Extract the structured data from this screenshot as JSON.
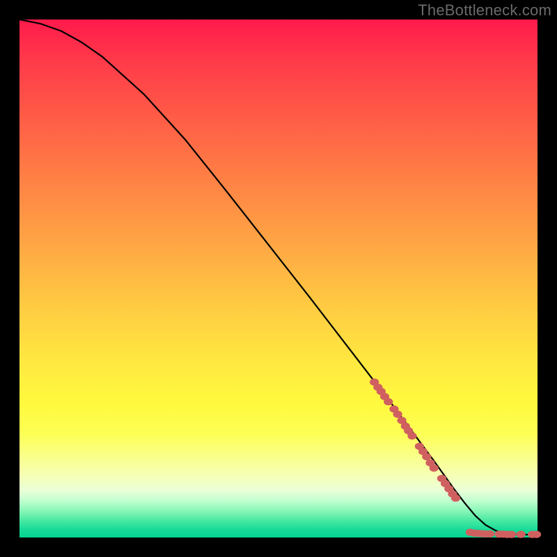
{
  "watermark": "TheBottleneck.com",
  "colors": {
    "marker": "#d06060",
    "line": "#000000",
    "frame": "#000000"
  },
  "chart_data": {
    "type": "line",
    "title": "",
    "xlabel": "",
    "ylabel": "",
    "xlim": [
      0,
      100
    ],
    "ylim": [
      0,
      100
    ],
    "series": [
      {
        "name": "curve",
        "x": [
          0,
          4,
          8,
          12,
          16,
          24,
          32,
          40,
          48,
          56,
          64,
          72,
          76,
          80,
          82,
          84,
          86,
          88,
          90,
          92,
          94,
          96,
          98,
          100
        ],
        "y": [
          100,
          99.2,
          97.8,
          95.6,
          92.8,
          85.6,
          76.8,
          66.8,
          56.6,
          46.4,
          36.0,
          25.6,
          20.2,
          14.8,
          12.0,
          9.2,
          6.6,
          4.2,
          2.4,
          1.3,
          0.8,
          0.6,
          0.55,
          0.55
        ]
      }
    ],
    "markers": [
      {
        "x": 68.5,
        "y": 30.0
      },
      {
        "x": 69.2,
        "y": 29.0
      },
      {
        "x": 69.8,
        "y": 28.2
      },
      {
        "x": 70.5,
        "y": 27.2
      },
      {
        "x": 71.2,
        "y": 26.2
      },
      {
        "x": 72.3,
        "y": 24.8
      },
      {
        "x": 73.0,
        "y": 23.8
      },
      {
        "x": 73.8,
        "y": 22.6
      },
      {
        "x": 74.5,
        "y": 21.5
      },
      {
        "x": 75.1,
        "y": 20.6
      },
      {
        "x": 75.8,
        "y": 19.6
      },
      {
        "x": 77.2,
        "y": 17.6
      },
      {
        "x": 77.9,
        "y": 16.6
      },
      {
        "x": 78.6,
        "y": 15.6
      },
      {
        "x": 79.3,
        "y": 14.4
      },
      {
        "x": 80.0,
        "y": 13.4
      },
      {
        "x": 81.5,
        "y": 11.4
      },
      {
        "x": 82.2,
        "y": 10.4
      },
      {
        "x": 82.9,
        "y": 9.4
      },
      {
        "x": 83.6,
        "y": 8.4
      },
      {
        "x": 84.2,
        "y": 7.6
      },
      {
        "x": 87.0,
        "y": 1.0
      },
      {
        "x": 87.8,
        "y": 0.85
      },
      {
        "x": 88.5,
        "y": 0.8
      },
      {
        "x": 89.3,
        "y": 0.75
      },
      {
        "x": 90.0,
        "y": 0.7
      },
      {
        "x": 90.8,
        "y": 0.7
      },
      {
        "x": 92.6,
        "y": 0.65
      },
      {
        "x": 93.4,
        "y": 0.65
      },
      {
        "x": 94.2,
        "y": 0.6
      },
      {
        "x": 95.0,
        "y": 0.6
      },
      {
        "x": 96.8,
        "y": 0.6
      },
      {
        "x": 99.0,
        "y": 0.6
      },
      {
        "x": 99.8,
        "y": 0.6
      }
    ]
  }
}
